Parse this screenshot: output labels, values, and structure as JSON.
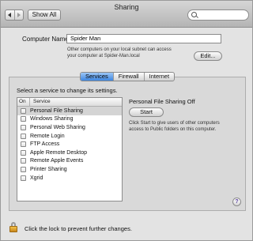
{
  "window": {
    "title": "Sharing"
  },
  "toolbar": {
    "show_all_label": "Show All",
    "search": {
      "value": ""
    }
  },
  "computer_name": {
    "label": "Computer Name:",
    "value": "Spider Man",
    "description_line1": "Other computers on your local subnet can access",
    "description_line2": "your computer at Spider-Man.local",
    "edit_button_label": "Edit..."
  },
  "tabs": [
    {
      "label": "Services",
      "active": true
    },
    {
      "label": "Firewall",
      "active": false
    },
    {
      "label": "Internet",
      "active": false
    }
  ],
  "services": {
    "instruction": "Select a service to change its settings.",
    "column_on": "On",
    "column_service": "Service",
    "items": [
      {
        "name": "Personal File Sharing",
        "on": false,
        "selected": true
      },
      {
        "name": "Windows Sharing",
        "on": false,
        "selected": false
      },
      {
        "name": "Personal Web Sharing",
        "on": false,
        "selected": false
      },
      {
        "name": "Remote Login",
        "on": false,
        "selected": false
      },
      {
        "name": "FTP Access",
        "on": false,
        "selected": false
      },
      {
        "name": "Apple Remote Desktop",
        "on": false,
        "selected": false
      },
      {
        "name": "Remote Apple Events",
        "on": false,
        "selected": false
      },
      {
        "name": "Printer Sharing",
        "on": false,
        "selected": false
      },
      {
        "name": "Xgrid",
        "on": false,
        "selected": false
      }
    ]
  },
  "detail": {
    "status": "Personal File Sharing Off",
    "start_button_label": "Start",
    "description_line1": "Click Start to give users of other computers",
    "description_line2": "access to Public folders on this computer."
  },
  "footer": {
    "lock_text": "Click the lock to prevent further changes."
  },
  "icons": {
    "back": "chevron-left-icon",
    "forward": "chevron-right-icon",
    "search": "search-icon",
    "help": "help-icon",
    "lock": "lock-icon"
  }
}
